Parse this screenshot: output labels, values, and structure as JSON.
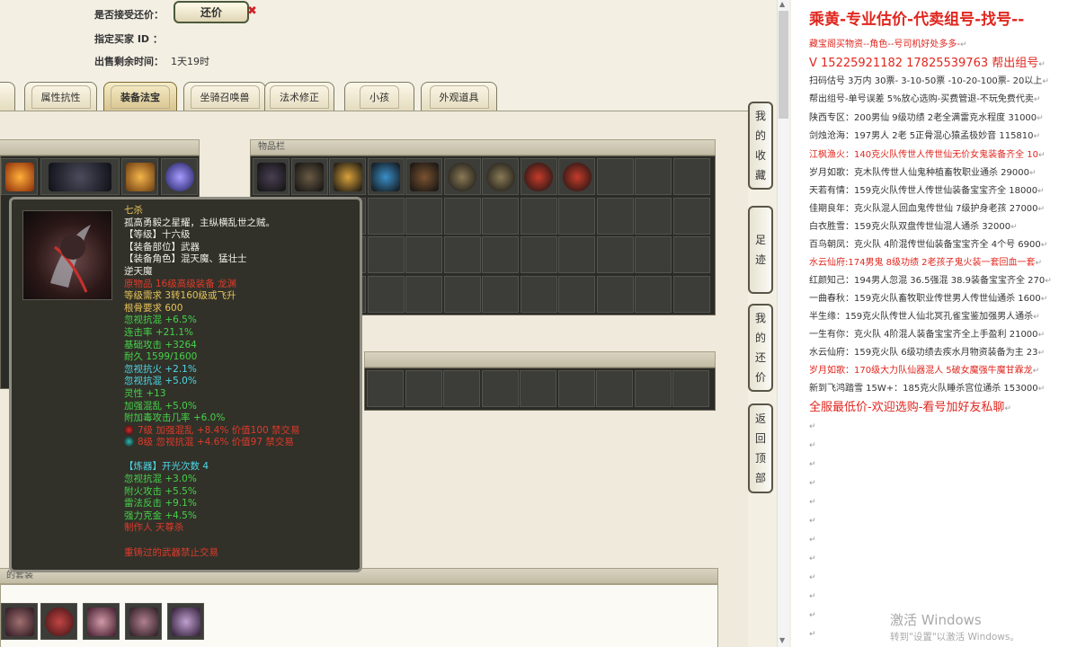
{
  "form": {
    "accept_label": "是否接受还价：",
    "counter_button": "还价",
    "close_x": "✖",
    "buyer_label": "指定买家 ID ：",
    "time_label": "出售剩余时间：",
    "time_value": "1天19时"
  },
  "tabs": [
    "属性抗性",
    "装备法宝",
    "坐骑召唤兽",
    "法术修正",
    "小孩",
    "外观道具"
  ],
  "active_tab": "装备法宝",
  "inventory": {
    "header": "物品栏"
  },
  "set_header": "的套装",
  "tooltip": {
    "lines": [
      {
        "t": "七杀",
        "c": "#e6c25a"
      },
      {
        "t": "孤高勇毅之星耀，主纵横乱世之贼。",
        "c": "#f0f0e6"
      },
      {
        "t": "【等级】十六级",
        "c": "#f0f0e6"
      },
      {
        "t": "【装备部位】武器",
        "c": "#f0f0e6"
      },
      {
        "t": "【装备角色】混天魔、猛壮士",
        "c": "#f0f0e6"
      },
      {
        "t": "逆天魔",
        "c": "#f0f0e6"
      },
      {
        "t": "原物品 16级高级装备 龙渊",
        "c": "#e03a2a"
      },
      {
        "t": "等级需求 3转160级或飞升",
        "c": "#e6c25a"
      },
      {
        "t": "根骨要求 600",
        "c": "#e6c25a"
      },
      {
        "t": "忽视抗混 +6.5%",
        "c": "#46d24a"
      },
      {
        "t": "连击率 +21.1%",
        "c": "#46d24a"
      },
      {
        "t": "基础攻击 +3264",
        "c": "#46d24a"
      },
      {
        "t": "耐久 1599/1600",
        "c": "#46d24a"
      },
      {
        "t": "忽视抗火 +2.1%",
        "c": "#4fd7e6"
      },
      {
        "t": "忽视抗混 +5.0%",
        "c": "#4fd7e6"
      },
      {
        "t": "灵性 +13",
        "c": "#46d24a"
      },
      {
        "t": "加强混乱 +5.0%",
        "c": "#46d24a"
      },
      {
        "t": "附加毒攻击几率 +6.0%",
        "c": "#46d24a"
      },
      {
        "t": "7级 加强混乱 +8.4% 价值100 禁交易",
        "c": "#e03a2a",
        "gem": "#d72a2a"
      },
      {
        "t": "8级 忽视抗混 +4.6% 价值97 禁交易",
        "c": "#e03a2a",
        "gem": "#2fb7b0"
      },
      {
        "t": "",
        "c": "#f0f0e6"
      },
      {
        "t": "【炼器】开光次数 4",
        "c": "#4fd7e6"
      },
      {
        "t": "忽视抗混 +3.0%",
        "c": "#46d24a"
      },
      {
        "t": "附火攻击 +5.5%",
        "c": "#46d24a"
      },
      {
        "t": "雷法反击 +9.1%",
        "c": "#46d24a"
      },
      {
        "t": "强力克金 +4.5%",
        "c": "#46d24a"
      },
      {
        "t": "制作人 天尊杀",
        "c": "#e03a2a"
      },
      {
        "t": "",
        "c": "#f0f0e6"
      },
      {
        "t": "重铸过的武器禁止交易",
        "c": "#e03a2a"
      }
    ]
  },
  "side_buttons": [
    {
      "label": "我的收藏"
    },
    {
      "label": "足迹"
    },
    {
      "label": "我的还价"
    },
    {
      "label": "返回顶部"
    }
  ],
  "doc": {
    "title": "乘黄-专业估价-代卖组号-找号--",
    "lines": [
      {
        "t": "藏宝阁买物资--角色--号司机好处多多-",
        "c": "red"
      },
      {
        "t": "V 15225921182  17825539763 帮出组号",
        "c": "red",
        "big": true
      },
      {
        "t": "扫码估号 3万内 30票- 3-10-50票  -10-20-100票- 20以上",
        "c": "dark"
      },
      {
        "t": "帮出组号-单号误差 5%放心选购-买费管退-不玩免费代卖",
        "c": "dark"
      },
      {
        "t": "陕西专区：200男仙 9级功绩 2老全满雷克水程度 31000",
        "c": "dark"
      },
      {
        "t": "剑烛沧海：197男人 2老 5正骨混心猿孟极妙音 115810",
        "c": "dark"
      },
      {
        "t": "江枫渔火：140克火队传世人传世仙无价女鬼装备齐全 10",
        "c": "red"
      },
      {
        "t": "岁月如歌：克木队传世人仙鬼种植畜牧职业通杀 29000",
        "c": "dark"
      },
      {
        "t": "天若有情：159克火队传世人传世仙装备宝宝齐全 18000",
        "c": "dark"
      },
      {
        "t": "佳期良年：克火队混人回血鬼传世仙 7级护身老孩 27000",
        "c": "dark"
      },
      {
        "t": "白衣胜雪：159克火队双盘传世仙混人通杀 32000",
        "c": "dark"
      },
      {
        "t": "百鸟朝凤：克火队 4阶混传世仙装备宝宝齐全 4个号 6900",
        "c": "dark"
      },
      {
        "t": "水云仙府:174男鬼 8级功绩 2老孩子鬼火装一套回血一套",
        "c": "red"
      },
      {
        "t": "红颜知己：194男人忽混 36.5强混 38.9装备宝宝齐全 270",
        "c": "dark"
      },
      {
        "t": "一曲春秋：159克火队畜牧职业传世男人传世仙通杀 1600",
        "c": "dark"
      },
      {
        "t": "半生缘：159克火队传世人仙北冥孔雀宝鉴加强男人通杀",
        "c": "dark"
      },
      {
        "t": "一生有你：克火队 4阶混人装备宝宝齐全上手盈利 21000",
        "c": "dark"
      },
      {
        "t": "水云仙府：159克火队 6级功绩去疾水月物资装备为主 23",
        "c": "dark"
      },
      {
        "t": "岁月如歌：170级大力队仙器混人 5破女魔强牛魔甘霖龙",
        "c": "red"
      },
      {
        "t": "新到飞鸿踏雪 15W+：185克火队睡杀宫位通杀 153000",
        "c": "dark"
      },
      {
        "t": "全服最低价-欢迎选购-看号加好友私聊",
        "c": "red",
        "big": true
      }
    ],
    "return_mark": "↵"
  },
  "watermark": {
    "line1": "激活 Windows",
    "line2": "转到\"设置\"以激活 Windows。"
  }
}
